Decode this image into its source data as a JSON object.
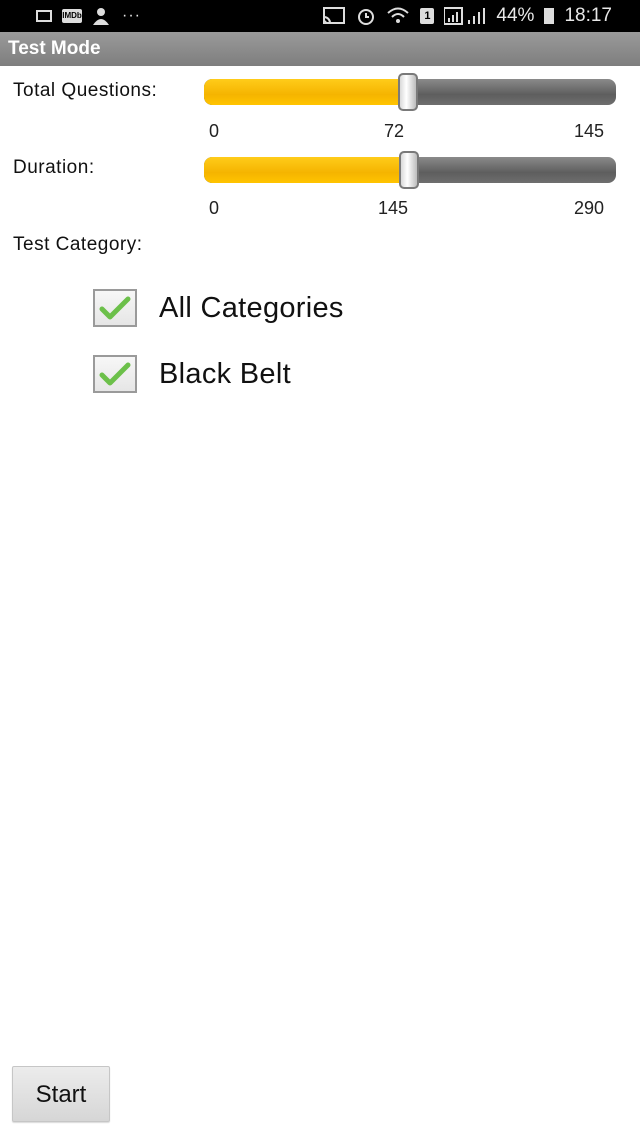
{
  "status_bar": {
    "left_icons": [
      "image-icon",
      "imdb-icon",
      "person-icon",
      "more-icon"
    ],
    "imdb_label": "IMDb",
    "more_label": "···",
    "battery_percent": "44%",
    "time": "18:17",
    "right_icons": [
      "cast-icon",
      "alarm-icon",
      "wifi-icon",
      "sim-icon",
      "signal-icon",
      "battery-icon"
    ]
  },
  "title_bar": {
    "title": "Test Mode"
  },
  "total_questions": {
    "label": "Total Questions:",
    "min": "0",
    "current": "72",
    "max": "145",
    "value": 72,
    "range": [
      0,
      145
    ]
  },
  "duration": {
    "label": "Duration:",
    "min": "0",
    "current": "145",
    "max": "290",
    "value": 145,
    "range": [
      0,
      290
    ]
  },
  "test_category": {
    "label": "Test Category:",
    "options": [
      {
        "label": "All Categories",
        "checked": true
      },
      {
        "label": "Black Belt",
        "checked": true
      }
    ]
  },
  "actions": {
    "start_label": "Start"
  },
  "colors": {
    "accent": "#F5B400",
    "check": "#6CC04A",
    "title_bar": "#8A8A8A"
  }
}
